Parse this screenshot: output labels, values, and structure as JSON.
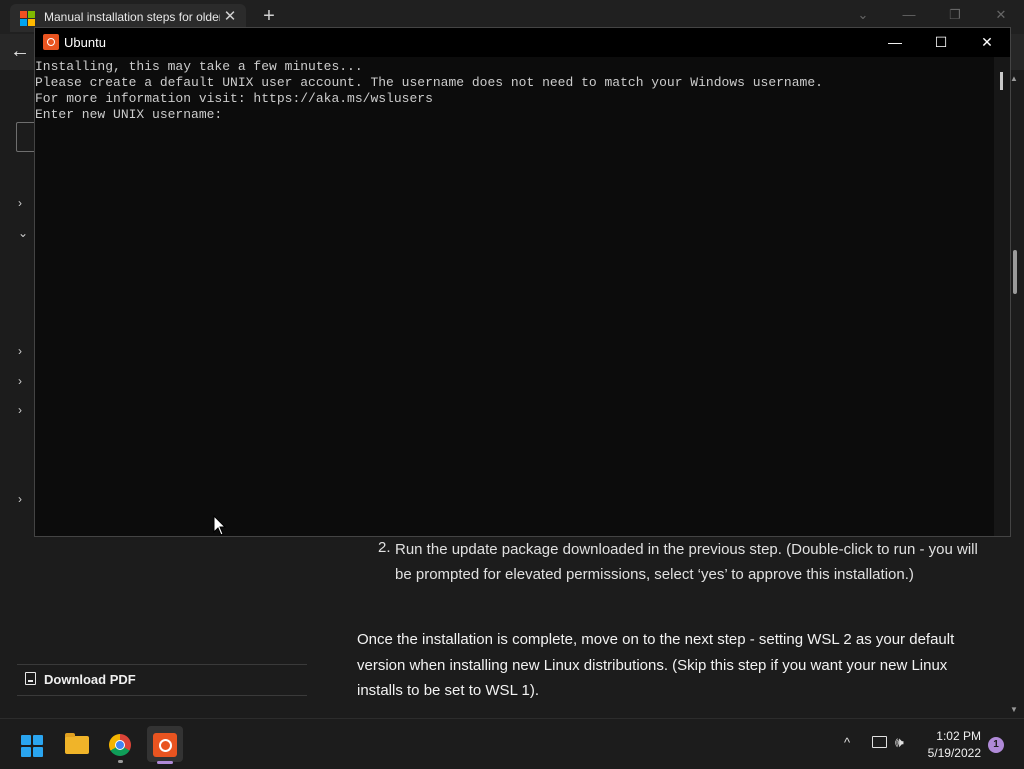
{
  "browser": {
    "tab_title": "Manual installation steps for older versions of WSL",
    "tab_close": "✕",
    "new_tab": "+",
    "back": "←"
  },
  "sidebar": {
    "download_pdf": "Download PDF"
  },
  "content": {
    "step_number": "2.",
    "step_text": "Run the update package downloaded in the previous step. (Double-click to run - you will be prompted for elevated permissions, select ‘yes’ to approve this installation.)",
    "paragraph": "Once the installation is complete, move on to the next step - setting WSL 2 as your default version when installing new Linux distributions. (Skip this step if you want your new Linux installs to be set to WSL 1)."
  },
  "terminal": {
    "title": "Ubuntu",
    "lines": [
      "Installing, this may take a few minutes...",
      "Please create a default UNIX user account. The username does not need to match your Windows username.",
      "For more information visit: https://aka.ms/wslusers",
      "Enter new UNIX username: "
    ],
    "minimize": "—",
    "maximize": "☐",
    "close": "✕"
  },
  "taskbar": {
    "time": "1:02 PM",
    "date": "5/19/2022",
    "notification_count": "1",
    "tray_chevron": "^",
    "volume": "🕪"
  },
  "colors": {
    "ubuntu_orange": "#e95420",
    "start_blue": "#2aa5f0",
    "accent_purple": "#b08ad8"
  },
  "icons": [
    "microsoft-logo-icon",
    "back-arrow-icon",
    "filter-icon",
    "chevron-right-icon",
    "chevron-down-icon",
    "pdf-icon",
    "ubuntu-icon",
    "start-icon",
    "file-explorer-icon",
    "chrome-icon",
    "network-icon",
    "volume-icon",
    "mouse-cursor-icon"
  ]
}
